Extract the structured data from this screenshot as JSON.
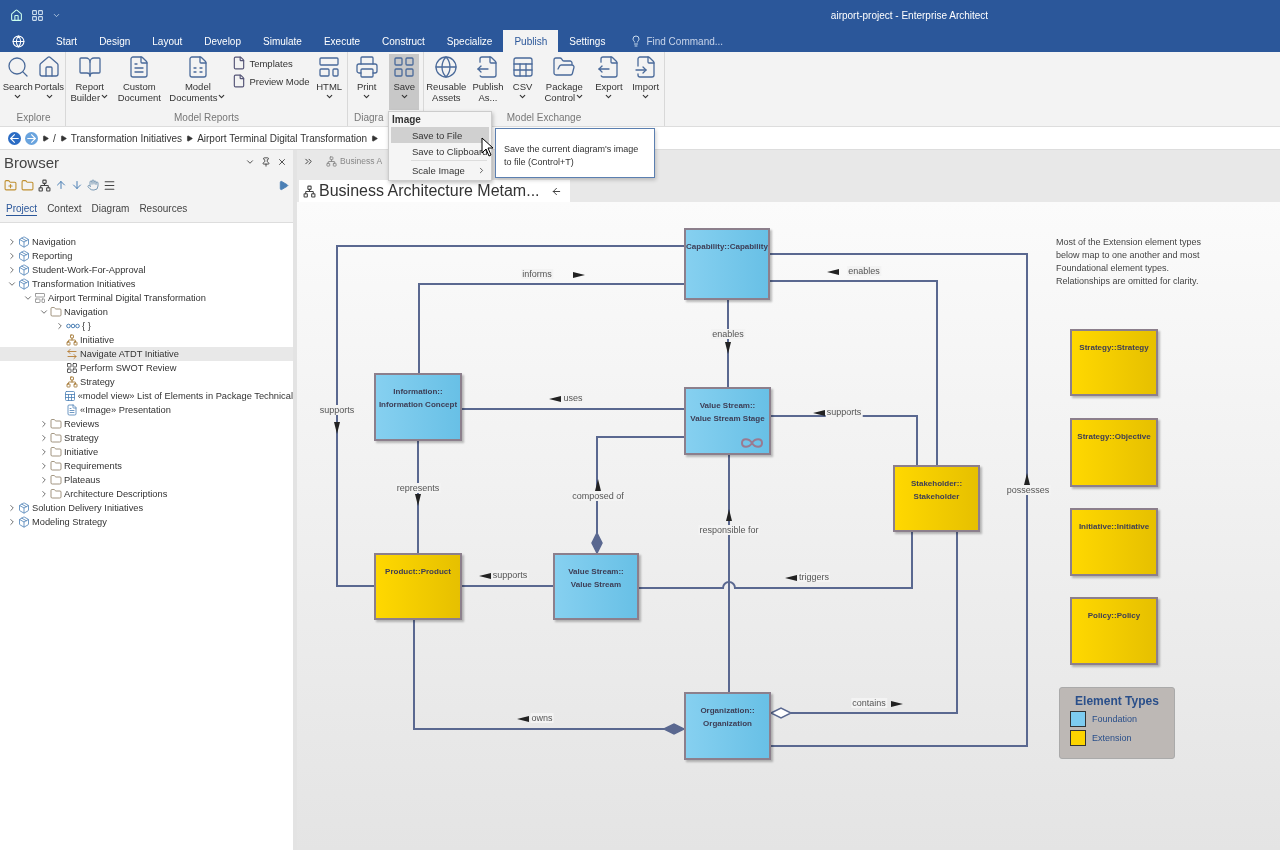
{
  "window": {
    "title": "airport-project - Enterprise Architect"
  },
  "ribbon_tabs": [
    {
      "label": "Start",
      "selected": false
    },
    {
      "label": "Design",
      "selected": false
    },
    {
      "label": "Layout",
      "selected": false
    },
    {
      "label": "Develop",
      "selected": false
    },
    {
      "label": "Simulate",
      "selected": false
    },
    {
      "label": "Execute",
      "selected": false
    },
    {
      "label": "Construct",
      "selected": false
    },
    {
      "label": "Specialize",
      "selected": false
    },
    {
      "label": "Publish",
      "selected": true
    },
    {
      "label": "Settings",
      "selected": false
    }
  ],
  "command_search": {
    "placeholder": "Find Command..."
  },
  "ribbon_groups": [
    {
      "label": "Explore",
      "buttons": [
        {
          "kind": "menu",
          "label": "Search",
          "pressed": false
        },
        {
          "kind": "menu",
          "label": "Portals",
          "pressed": false
        }
      ]
    },
    {
      "label": "Model Reports",
      "buttons": [
        {
          "kind": "wrapmenu",
          "label": "Report Builder",
          "pressed": false
        },
        {
          "kind": "plain",
          "label": "Custom Document",
          "pressed": false
        },
        {
          "kind": "wrapmenu",
          "label": "Model Documents",
          "pressed": false
        },
        {
          "kind": "stack",
          "items": [
            "Templates",
            "Preview Mode"
          ]
        },
        {
          "kind": "menu",
          "label": "HTML",
          "pressed": false
        }
      ]
    },
    {
      "label": "Diagra",
      "buttons": [
        {
          "kind": "menu",
          "label": "Print",
          "pressed": false
        },
        {
          "kind": "menu",
          "label": "Save",
          "pressed": true
        }
      ]
    },
    {
      "label": "Model Exchange",
      "buttons": [
        {
          "kind": "plain",
          "label": "Reusable Assets",
          "pressed": false
        },
        {
          "kind": "plain",
          "label": "Publish As...",
          "pressed": false
        },
        {
          "kind": "menu",
          "label": "CSV",
          "pressed": false
        },
        {
          "kind": "wrapmenu",
          "label": "Package Control",
          "pressed": false
        },
        {
          "kind": "menu",
          "label": "Export",
          "pressed": false
        },
        {
          "kind": "menu",
          "label": "Import",
          "pressed": false
        }
      ]
    }
  ],
  "breadcrumb": [
    "/",
    "Transformation Initiatives",
    "Airport Terminal Digital Transformation"
  ],
  "browser": {
    "title": "Browser",
    "tabs": [
      {
        "label": "Project",
        "selected": true
      },
      {
        "label": "Context",
        "selected": false
      },
      {
        "label": "Diagram",
        "selected": false
      },
      {
        "label": "Resources",
        "selected": false
      }
    ],
    "tree": [
      {
        "label": "Navigation",
        "kind": "package",
        "expanded": false,
        "selected": false
      },
      {
        "label": "Reporting",
        "kind": "package",
        "expanded": false,
        "selected": false
      },
      {
        "label": "Student-Work-For-Approval",
        "kind": "package",
        "expanded": false,
        "selected": false
      },
      {
        "label": "Transformation Initiatives",
        "kind": "package",
        "expanded": true,
        "selected": false,
        "children": [
          {
            "label": "Airport Terminal Digital Transformation",
            "kind": "model",
            "expanded": true,
            "selected": false,
            "children": [
              {
                "label": "Navigation",
                "kind": "folder",
                "expanded": true,
                "selected": false,
                "children": [
                  {
                    "label": "{ }",
                    "kind": "group",
                    "expanded": false,
                    "selected": false
                  },
                  {
                    "label": "Initiative",
                    "kind": "hierarchy",
                    "selected": false
                  },
                  {
                    "label": "Navigate ATDT Initiative",
                    "kind": "link",
                    "selected": true
                  },
                  {
                    "label": "Perform SWOT Review",
                    "kind": "grid",
                    "selected": false
                  },
                  {
                    "label": "Strategy",
                    "kind": "hierarchy",
                    "selected": false
                  },
                  {
                    "label": "«model view» List of Elements in Package Technical",
                    "kind": "view",
                    "selected": false
                  },
                  {
                    "label": "«Image» Presentation",
                    "kind": "document",
                    "selected": false
                  }
                ]
              },
              {
                "label": "Reviews",
                "kind": "folder",
                "expanded": false,
                "selected": false
              },
              {
                "label": "Strategy",
                "kind": "folder",
                "expanded": false,
                "selected": false
              },
              {
                "label": "Initiative",
                "kind": "folder",
                "expanded": false,
                "selected": false
              },
              {
                "label": "Requirements",
                "kind": "folder",
                "expanded": false,
                "selected": false
              },
              {
                "label": "Plateaus",
                "kind": "folder",
                "expanded": false,
                "selected": false
              },
              {
                "label": "Architecture Descriptions",
                "kind": "folder",
                "expanded": false,
                "selected": false
              }
            ]
          }
        ]
      },
      {
        "label": "Solution Delivery Initiatives",
        "kind": "package",
        "expanded": false,
        "selected": false
      },
      {
        "label": "Modeling Strategy",
        "kind": "package",
        "expanded": false,
        "selected": false
      }
    ]
  },
  "document_tabs": [
    {
      "label": "Business A"
    }
  ],
  "diagram": {
    "title": "Business Architecture Metam...",
    "nodes": [
      {
        "kind": "foundation",
        "lines": [
          "Capability::Capability"
        ]
      },
      {
        "kind": "foundation",
        "lines": [
          "Information::",
          "Information Concept"
        ]
      },
      {
        "kind": "foundation",
        "lines": [
          "Value Stream::",
          "Value Stream Stage"
        ]
      },
      {
        "kind": "extension",
        "lines": [
          "Stakeholder::",
          "Stakeholder"
        ]
      },
      {
        "kind": "extension",
        "lines": [
          "Product::Product"
        ]
      },
      {
        "kind": "foundation",
        "lines": [
          "Value Stream::",
          "Value Stream"
        ]
      },
      {
        "kind": "foundation",
        "lines": [
          "Organization::",
          "Organization"
        ]
      },
      {
        "kind": "extension",
        "lines": [
          "Strategy::Strategy"
        ]
      },
      {
        "kind": "extension",
        "lines": [
          "Strategy::Objective"
        ]
      },
      {
        "kind": "extension",
        "lines": [
          "Initiative::Initiative"
        ]
      },
      {
        "kind": "extension",
        "lines": [
          "Policy::Policy"
        ]
      }
    ],
    "connectors": [
      {
        "label": "supports"
      },
      {
        "label": "informs"
      },
      {
        "label": "enables"
      },
      {
        "label": "enables"
      },
      {
        "label": "possesses"
      },
      {
        "label": "uses"
      },
      {
        "label": "supports"
      },
      {
        "label": "composed of"
      },
      {
        "label": "responsible for"
      },
      {
        "label": "represents"
      },
      {
        "label": "supports"
      },
      {
        "label": "triggers"
      },
      {
        "label": "owns"
      },
      {
        "label": "contains"
      }
    ],
    "note": "Most of the Extension element types below map to one another and most Foundational element types. Relationships are omitted for clarity.",
    "legend": {
      "title": "Element Types",
      "items": [
        {
          "label": "Foundation",
          "color": "#7dcbef"
        },
        {
          "label": "Extension",
          "color": "#fcd400"
        }
      ]
    }
  },
  "menu": {
    "header": "Image",
    "items": [
      {
        "label": "Save to File",
        "highlighted": true,
        "submenu": false
      },
      {
        "label": "Save to Clipboard",
        "highlighted": false,
        "submenu": false
      },
      {
        "label": "Scale Image",
        "highlighted": false,
        "submenu": true
      }
    ]
  },
  "tooltip": "Save the current diagram's image to file (Control+T)"
}
